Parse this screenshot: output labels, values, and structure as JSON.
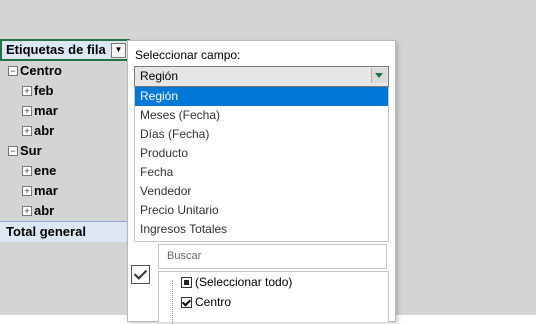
{
  "pivot": {
    "header_label": "Etiquetas de fila",
    "rows": [
      {
        "label": "Centro",
        "level": 1,
        "expander": "minus"
      },
      {
        "label": "feb",
        "level": 2,
        "expander": "plus"
      },
      {
        "label": "mar",
        "level": 2,
        "expander": "plus"
      },
      {
        "label": "abr",
        "level": 2,
        "expander": "plus"
      },
      {
        "label": "Sur",
        "level": 1,
        "expander": "minus"
      },
      {
        "label": "ene",
        "level": 2,
        "expander": "plus"
      },
      {
        "label": "mar",
        "level": 2,
        "expander": "plus"
      },
      {
        "label": "abr",
        "level": 2,
        "expander": "plus"
      }
    ],
    "total_label": "Total general"
  },
  "panel": {
    "title": "Seleccionar campo:",
    "selected_field": "Región",
    "fields": [
      "Región",
      "Meses (Fecha)",
      "Días (Fecha)",
      "Producto",
      "Fecha",
      "Vendedor",
      "Precio Unitario",
      "Ingresos Totales"
    ],
    "search_placeholder": "Buscar",
    "tree": [
      {
        "label": "(Seleccionar todo)",
        "state": "partial"
      },
      {
        "label": "Centro",
        "state": "checked"
      }
    ]
  },
  "colors": {
    "accent": "#217346",
    "selection": "#0078d7",
    "header_fill": "#dde7f3"
  }
}
